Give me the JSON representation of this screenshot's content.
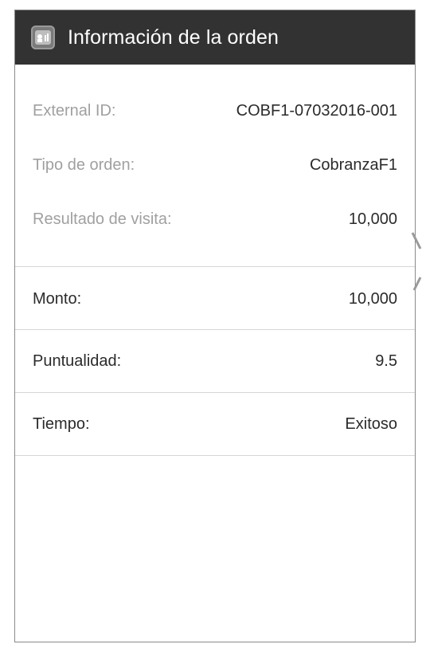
{
  "header": {
    "title": "Información de la orden",
    "icon": "app-icon"
  },
  "info": [
    {
      "label": "External ID:",
      "value": "COBF1-07032016-001"
    },
    {
      "label": "Tipo de orden:",
      "value": "CobranzaF1"
    },
    {
      "label": "Resultado de visita:",
      "value": "10,000"
    }
  ],
  "details": [
    {
      "label": "Monto:",
      "value": "10,000"
    },
    {
      "label": "Puntualidad:",
      "value": "9.5"
    },
    {
      "label": "Tiempo:",
      "value": "Exitoso"
    }
  ]
}
